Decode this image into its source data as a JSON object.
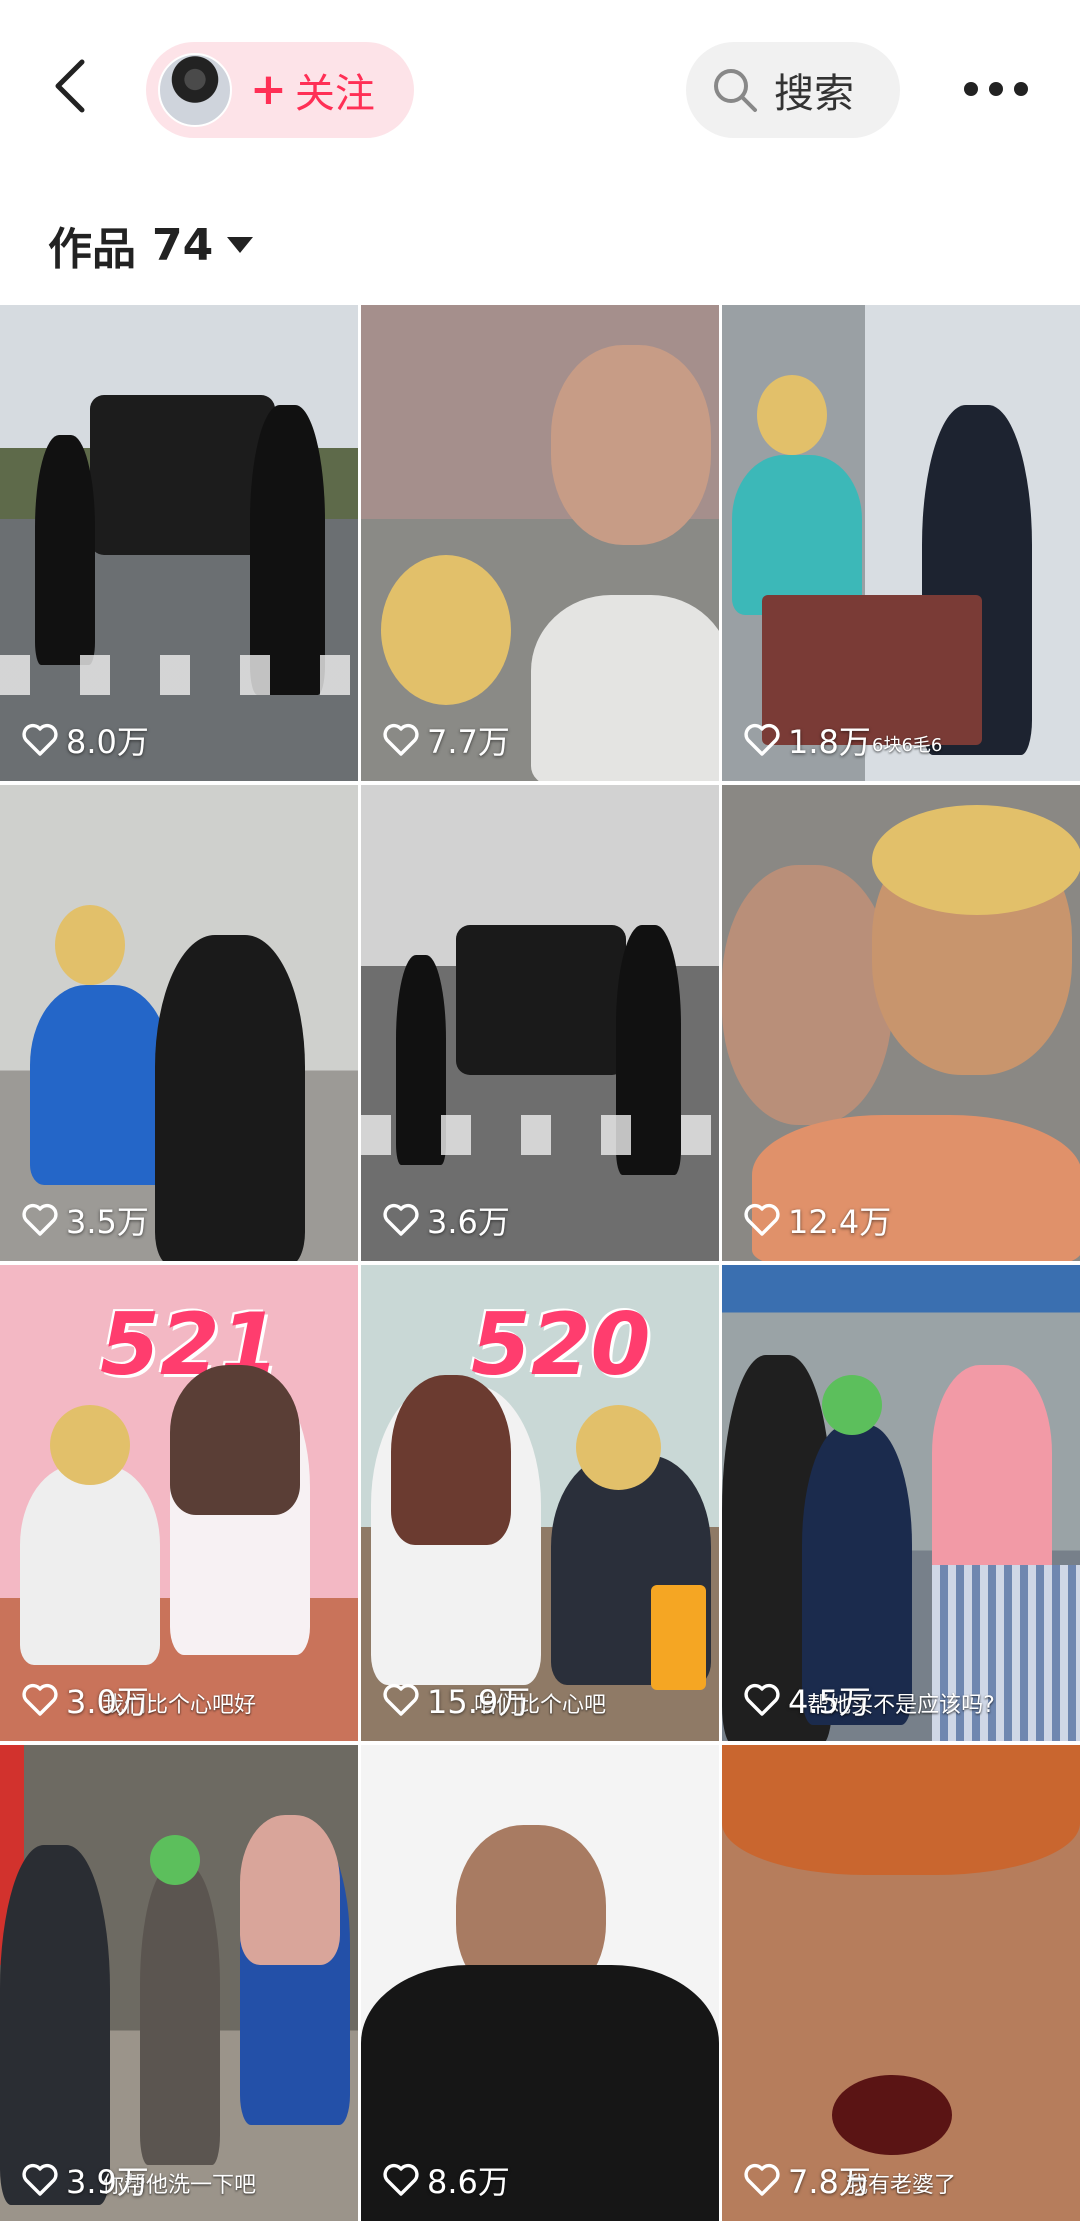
{
  "header": {
    "follow_plus": "+",
    "follow_label": "关注",
    "search_label": "搜索"
  },
  "works": {
    "label": "作品",
    "count": "74"
  },
  "icons": [
    "back-arrow-icon",
    "search-icon",
    "more-icon",
    "caret-down-icon",
    "heart-icon"
  ],
  "colors": {
    "accent": "#ff2f55"
  },
  "tiles": [
    {
      "likes": "8.0万",
      "caption": ""
    },
    {
      "likes": "7.7万",
      "caption": ""
    },
    {
      "likes": "1.8万",
      "caption": "6块6毛6"
    },
    {
      "likes": "3.5万",
      "caption": ""
    },
    {
      "likes": "3.6万",
      "caption": ""
    },
    {
      "likes": "12.4万",
      "caption": ""
    },
    {
      "likes": "3.0万",
      "caption": "我们比个心吧好",
      "overlay": "521"
    },
    {
      "likes": "15.9万",
      "caption": "咱们比个心吧",
      "overlay": "520"
    },
    {
      "likes": "4.5万",
      "caption": "帮她买不是应该吗?"
    },
    {
      "likes": "3.9万",
      "caption": "你帮他洗一下吧"
    },
    {
      "likes": "8.6万",
      "caption": ""
    },
    {
      "likes": "7.8万",
      "caption": "我有老婆了"
    }
  ]
}
